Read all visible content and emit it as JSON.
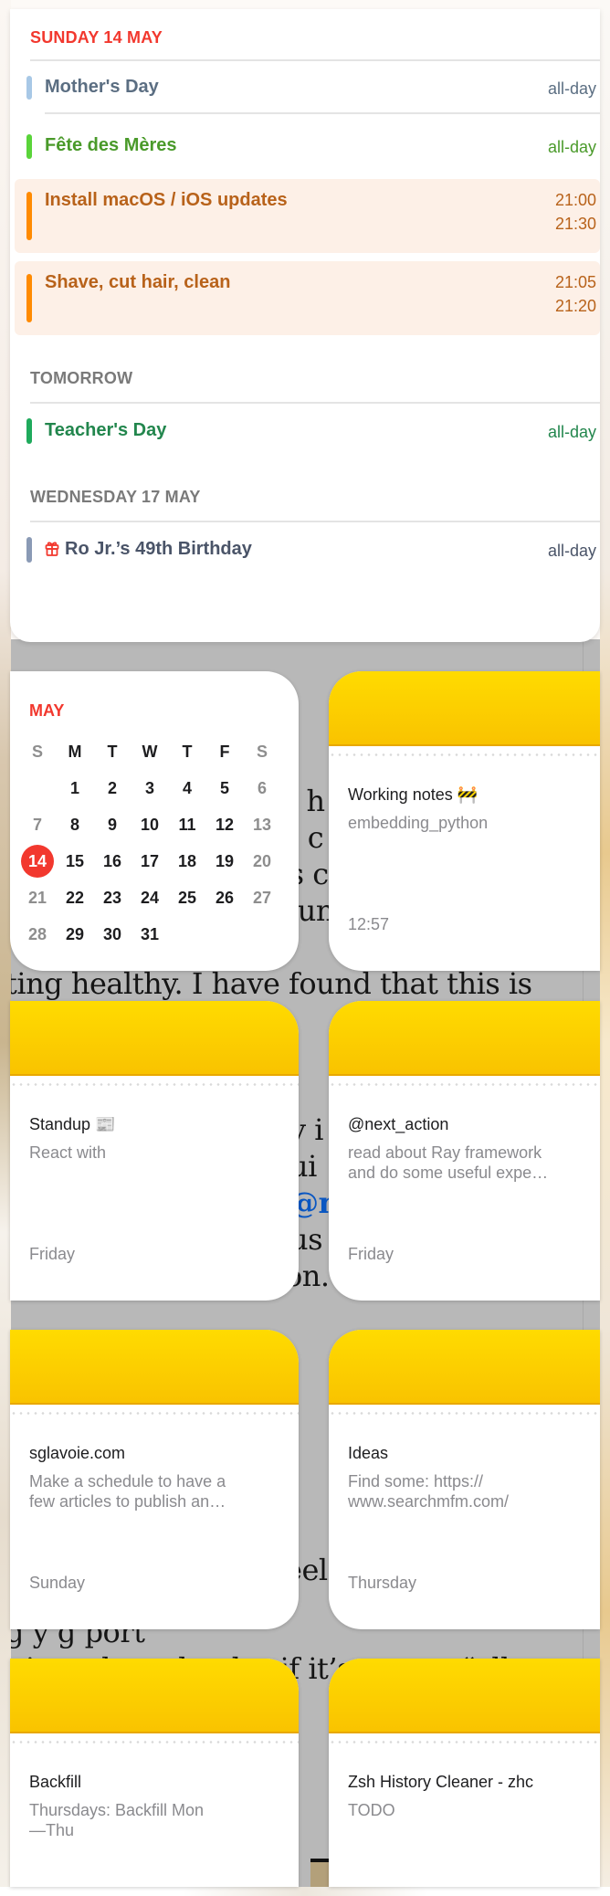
{
  "events_widget": {
    "sections": [
      {
        "header": "SUNDAY 14 MAY",
        "header_color": "#f2382e",
        "events": [
          {
            "title": "Mother's Day",
            "time": "all-day",
            "bar_color": "#a8c8e6",
            "text_color": "#5b6e82",
            "highlight": false
          },
          {
            "title": "Fête des Mères",
            "time": "all-day",
            "bar_color": "#5ad43a",
            "text_color": "#4a9a2a",
            "highlight": false
          },
          {
            "title": "Install macOS / iOS updates",
            "time_start": "21:00",
            "time_end": "21:30",
            "bar_color": "#ff8a00",
            "text_color": "#b8621a",
            "highlight": true
          },
          {
            "title": "Shave, cut hair, clean",
            "time_start": "21:05",
            "time_end": "21:20",
            "bar_color": "#ff8a00",
            "text_color": "#b8621a",
            "highlight": true
          }
        ]
      },
      {
        "header": "TOMORROW",
        "header_color": "#7a7a7a",
        "events": [
          {
            "title": "Teacher's Day",
            "time": "all-day",
            "bar_color": "#1faa5c",
            "text_color": "#22864d",
            "highlight": false
          }
        ]
      },
      {
        "header": "WEDNESDAY 17 MAY",
        "header_color": "#7a7a7a",
        "events": [
          {
            "title": "Ro Jr.’s 49th Birthday",
            "time": "all-day",
            "bar_color": "#8a9ab5",
            "text_color": "#4a5468",
            "icon": "gift-icon",
            "icon_color": "#f2382e",
            "highlight": false
          }
        ]
      }
    ]
  },
  "calendar_widget": {
    "month": "MAY",
    "weekdays": [
      "S",
      "M",
      "T",
      "W",
      "T",
      "F",
      "S"
    ],
    "weeks": [
      [
        "",
        "1",
        "2",
        "3",
        "4",
        "5",
        "6"
      ],
      [
        "7",
        "8",
        "9",
        "10",
        "11",
        "12",
        "13"
      ],
      [
        "14",
        "15",
        "16",
        "17",
        "18",
        "19",
        "20"
      ],
      [
        "21",
        "22",
        "23",
        "24",
        "25",
        "26",
        "27"
      ],
      [
        "28",
        "29",
        "30",
        "31",
        "",
        "",
        ""
      ]
    ],
    "today": "14",
    "accent": "#f2382e"
  },
  "notes": [
    {
      "title": "Working notes 🚧",
      "body": "embedding_python",
      "date": "12:57"
    },
    {
      "title": "Standup 📰",
      "body": "React with",
      "date": "Friday"
    },
    {
      "title": "@next_action",
      "body": "read about Ray framework\nand do some useful expe…",
      "date": "Friday"
    },
    {
      "title": "sglavoie.com",
      "body": "Make a schedule to have a\nfew articles to publish an…",
      "date": "Sunday"
    },
    {
      "title": "Ideas",
      "body": "Find some: https://\nwww.searchmfm.com/",
      "date": "Thursday"
    },
    {
      "title": "Backfill",
      "body": "Thursdays: Backfill Mon\n—Thu",
      "date": ""
    },
    {
      "title": "Zsh History Cleaner - zhc",
      "body": "TODO",
      "date": ""
    }
  ],
  "background_page": {
    "lines": [
      "o h",
      "n c",
      "’s c",
      "ounı",
      "ting healthy. I have found that this is",
      "y i",
      "ui",
      "@n",
      "us",
      "on.",
      "eel",
      "g             y    g   port",
      "t into the calendar if it’s not an “all"
    ]
  }
}
